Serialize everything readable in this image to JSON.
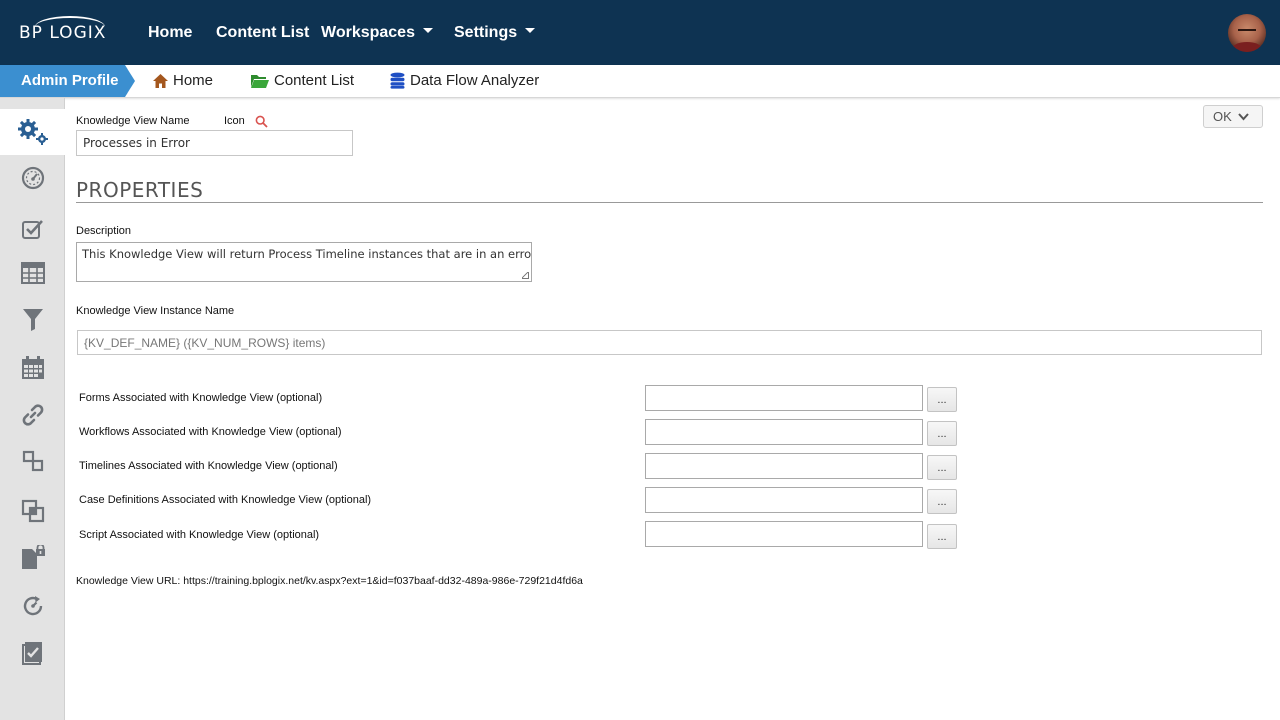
{
  "brand": {
    "logo_text": "BP LOGIX"
  },
  "topnav": {
    "home": "Home",
    "content_list": "Content List",
    "workspaces": "Workspaces",
    "settings": "Settings"
  },
  "subnav": {
    "active_crumb": "Admin Profile",
    "home": "Home",
    "content_list": "Content List",
    "data_flow_analyzer": "Data Flow Analyzer"
  },
  "sidebar": {
    "items": [
      {
        "icon": "gears-icon",
        "active": true
      },
      {
        "icon": "dashboard-gauge-icon"
      },
      {
        "icon": "checkbox-edit-icon"
      },
      {
        "icon": "table-grid-icon"
      },
      {
        "icon": "funnel-filter-icon"
      },
      {
        "icon": "calendar-icon"
      },
      {
        "icon": "link-chain-icon"
      },
      {
        "icon": "connected-boxes-icon"
      },
      {
        "icon": "copy-squares-icon"
      },
      {
        "icon": "locked-document-icon"
      },
      {
        "icon": "refresh-timer-icon"
      },
      {
        "icon": "task-clipboard-icon"
      }
    ]
  },
  "header_actions": {
    "ok_label": "OK"
  },
  "form": {
    "kv_name_label": "Knowledge View Name",
    "icon_label": "Icon",
    "kv_name_value": "Processes in Error",
    "properties_heading": "PROPERTIES",
    "description_label": "Description",
    "description_value": "This Knowledge View will return Process Timeline instances that are in an error state.",
    "instance_name_label": "Knowledge View Instance Name",
    "instance_name_value": "{KV_DEF_NAME} ({KV_NUM_ROWS} items)",
    "associations": [
      {
        "label": "Forms Associated with Knowledge View (optional)",
        "value": "",
        "button": "..."
      },
      {
        "label": "Workflows Associated with Knowledge View (optional)",
        "value": "",
        "button": "..."
      },
      {
        "label": "Timelines Associated with Knowledge View (optional)",
        "value": "",
        "button": "..."
      },
      {
        "label": "Case Definitions Associated with Knowledge View (optional)",
        "value": "",
        "button": "..."
      },
      {
        "label": "Script Associated with Knowledge View (optional)",
        "value": "",
        "button": "..."
      }
    ],
    "kv_url": "Knowledge View URL: https://training.bplogix.net/kv.aspx?ext=1&id=f037baaf-dd32-489a-986e-729f21d4fd6a"
  },
  "colors": {
    "topbar": "#0e3352",
    "crumb_active": "#3b8fd0",
    "sidebar_icon": "#6f747a",
    "sidebar_active_icon": "#2a5f93",
    "search_icon": "#d9534f"
  }
}
